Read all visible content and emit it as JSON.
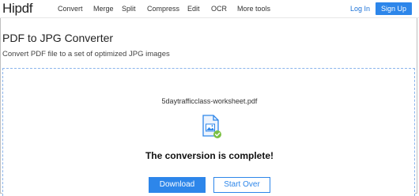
{
  "brand": {
    "logo": "Hipdf"
  },
  "nav": {
    "items": [
      "Convert",
      "Merge",
      "Split",
      "Compress",
      "Edit",
      "OCR",
      "More tools"
    ],
    "login": "Log In",
    "signup": "Sign Up"
  },
  "page": {
    "title": "PDF to JPG Converter",
    "subtitle": "Convert PDF file to a set of optimized JPG images"
  },
  "result": {
    "filename": "5daytrafficclass-worksheet.pdf",
    "status": "The conversion is complete!",
    "file_icon": "image-file-icon",
    "check_icon": "check-icon"
  },
  "actions": {
    "download": "Download",
    "start_over": "Start Over"
  },
  "colors": {
    "accent": "#2d86ea",
    "check": "#7bc043",
    "dashed_border": "#8ab4ec"
  }
}
